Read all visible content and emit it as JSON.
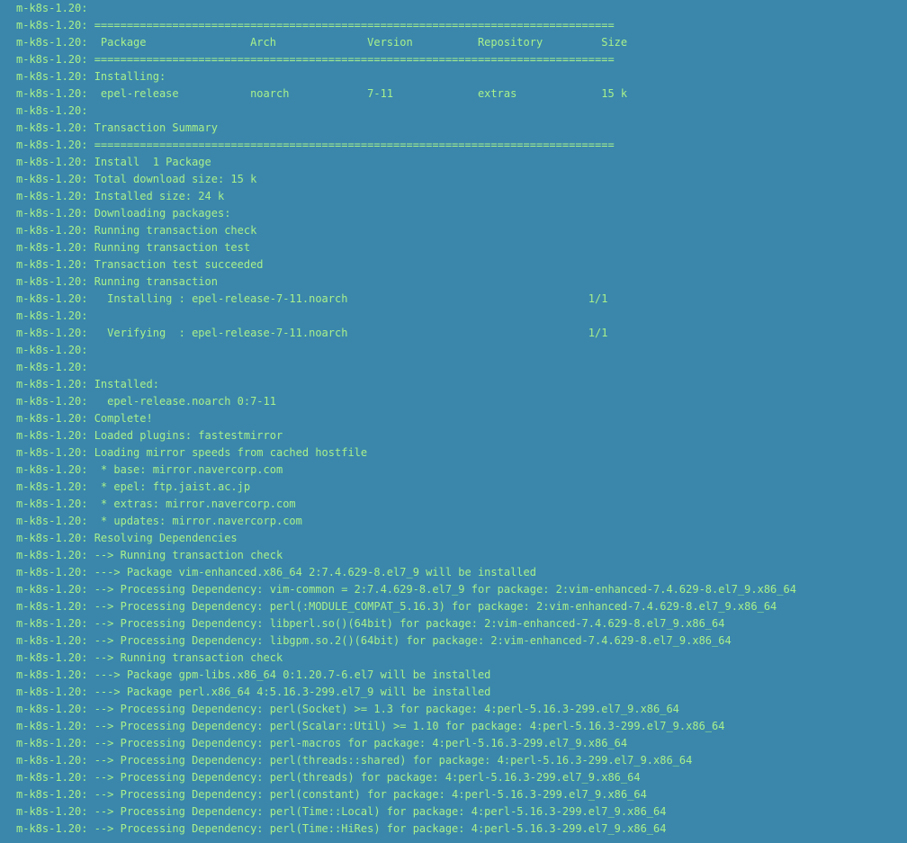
{
  "terminal": {
    "text_color": "#a8f08c",
    "background_color": "#3a87ab",
    "lines": [
      "m-k8s-1.20: ",
      "m-k8s-1.20: ================================================================================",
      "m-k8s-1.20:  Package                Arch              Version          Repository         Size",
      "m-k8s-1.20: ================================================================================",
      "m-k8s-1.20: Installing:",
      "m-k8s-1.20:  epel-release           noarch            7-11             extras             15 k",
      "m-k8s-1.20: ",
      "m-k8s-1.20: Transaction Summary",
      "m-k8s-1.20: ================================================================================",
      "m-k8s-1.20: Install  1 Package",
      "m-k8s-1.20: Total download size: 15 k",
      "m-k8s-1.20: Installed size: 24 k",
      "m-k8s-1.20: Downloading packages:",
      "m-k8s-1.20: Running transaction check",
      "m-k8s-1.20: Running transaction test",
      "m-k8s-1.20: Transaction test succeeded",
      "m-k8s-1.20: Running transaction",
      "m-k8s-1.20:   Installing : epel-release-7-11.noarch                                     1/1",
      "m-k8s-1.20: ",
      "m-k8s-1.20:   Verifying  : epel-release-7-11.noarch                                     1/1",
      "m-k8s-1.20: ",
      "m-k8s-1.20: ",
      "m-k8s-1.20: Installed:",
      "m-k8s-1.20:   epel-release.noarch 0:7-11",
      "m-k8s-1.20: Complete!",
      "m-k8s-1.20: Loaded plugins: fastestmirror",
      "m-k8s-1.20: Loading mirror speeds from cached hostfile",
      "m-k8s-1.20:  * base: mirror.navercorp.com",
      "m-k8s-1.20:  * epel: ftp.jaist.ac.jp",
      "m-k8s-1.20:  * extras: mirror.navercorp.com",
      "m-k8s-1.20:  * updates: mirror.navercorp.com",
      "m-k8s-1.20: Resolving Dependencies",
      "m-k8s-1.20: --> Running transaction check",
      "m-k8s-1.20: ---> Package vim-enhanced.x86_64 2:7.4.629-8.el7_9 will be installed",
      "m-k8s-1.20: --> Processing Dependency: vim-common = 2:7.4.629-8.el7_9 for package: 2:vim-enhanced-7.4.629-8.el7_9.x86_64",
      "m-k8s-1.20: --> Processing Dependency: perl(:MODULE_COMPAT_5.16.3) for package: 2:vim-enhanced-7.4.629-8.el7_9.x86_64",
      "m-k8s-1.20: --> Processing Dependency: libperl.so()(64bit) for package: 2:vim-enhanced-7.4.629-8.el7_9.x86_64",
      "m-k8s-1.20: --> Processing Dependency: libgpm.so.2()(64bit) for package: 2:vim-enhanced-7.4.629-8.el7_9.x86_64",
      "m-k8s-1.20: --> Running transaction check",
      "m-k8s-1.20: ---> Package gpm-libs.x86_64 0:1.20.7-6.el7 will be installed",
      "m-k8s-1.20: ---> Package perl.x86_64 4:5.16.3-299.el7_9 will be installed",
      "m-k8s-1.20: --> Processing Dependency: perl(Socket) >= 1.3 for package: 4:perl-5.16.3-299.el7_9.x86_64",
      "m-k8s-1.20: --> Processing Dependency: perl(Scalar::Util) >= 1.10 for package: 4:perl-5.16.3-299.el7_9.x86_64",
      "m-k8s-1.20: --> Processing Dependency: perl-macros for package: 4:perl-5.16.3-299.el7_9.x86_64",
      "m-k8s-1.20: --> Processing Dependency: perl(threads::shared) for package: 4:perl-5.16.3-299.el7_9.x86_64",
      "m-k8s-1.20: --> Processing Dependency: perl(threads) for package: 4:perl-5.16.3-299.el7_9.x86_64",
      "m-k8s-1.20: --> Processing Dependency: perl(constant) for package: 4:perl-5.16.3-299.el7_9.x86_64",
      "m-k8s-1.20: --> Processing Dependency: perl(Time::Local) for package: 4:perl-5.16.3-299.el7_9.x86_64",
      "m-k8s-1.20: --> Processing Dependency: perl(Time::HiRes) for package: 4:perl-5.16.3-299.el7_9.x86_64"
    ]
  }
}
